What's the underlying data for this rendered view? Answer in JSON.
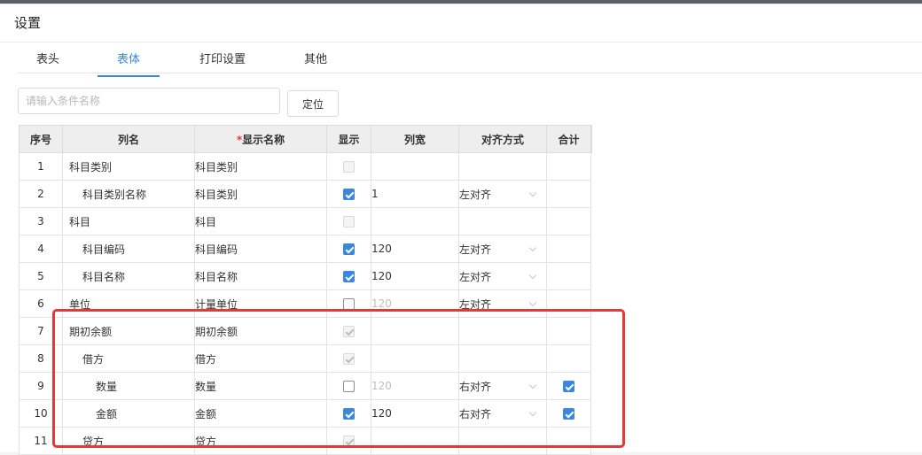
{
  "dialog": {
    "title": "设置"
  },
  "tabs": [
    {
      "label": "表头",
      "active": false
    },
    {
      "label": "表体",
      "active": true
    },
    {
      "label": "打印设置",
      "active": false
    },
    {
      "label": "其他",
      "active": false
    }
  ],
  "search": {
    "placeholder": "请输入条件名称",
    "value": "",
    "button_label": "定位"
  },
  "table": {
    "headers": {
      "no": "序号",
      "col_name": "列名",
      "required_mark": "*",
      "display_name": "显示名称",
      "show": "显示",
      "width": "列宽",
      "align": "对齐方式",
      "sum": "合计"
    },
    "rows": [
      {
        "no": "1",
        "col_name": "科目类别",
        "indent": 0,
        "display_name": "科目类别",
        "show": "disabled",
        "width": "",
        "width_muted": false,
        "align": "",
        "sum": ""
      },
      {
        "no": "2",
        "col_name": "科目类别名称",
        "indent": 1,
        "display_name": "科目类别",
        "show": "checked",
        "width": "1",
        "width_muted": false,
        "align": "左对齐",
        "sum": ""
      },
      {
        "no": "3",
        "col_name": "科目",
        "indent": 0,
        "display_name": "科目",
        "show": "disabled",
        "width": "",
        "width_muted": false,
        "align": "",
        "sum": ""
      },
      {
        "no": "4",
        "col_name": "科目编码",
        "indent": 1,
        "display_name": "科目编码",
        "show": "checked",
        "width": "120",
        "width_muted": false,
        "align": "左对齐",
        "sum": ""
      },
      {
        "no": "5",
        "col_name": "科目名称",
        "indent": 1,
        "display_name": "科目名称",
        "show": "checked",
        "width": "120",
        "width_muted": false,
        "align": "左对齐",
        "sum": ""
      },
      {
        "no": "6",
        "col_name": "单位",
        "indent": 0,
        "display_name": "计量单位",
        "show": "empty",
        "width": "120",
        "width_muted": true,
        "align": "左对齐",
        "sum": ""
      },
      {
        "no": "7",
        "col_name": "期初余额",
        "indent": 0,
        "display_name": "期初余额",
        "show": "disabled-checked",
        "width": "",
        "width_muted": false,
        "align": "",
        "sum": ""
      },
      {
        "no": "8",
        "col_name": "借方",
        "indent": 1,
        "display_name": "借方",
        "show": "disabled-checked",
        "width": "",
        "width_muted": false,
        "align": "",
        "sum": ""
      },
      {
        "no": "9",
        "col_name": "数量",
        "indent": 2,
        "display_name": "数量",
        "show": "empty",
        "width": "120",
        "width_muted": true,
        "align": "右对齐",
        "sum": "checked"
      },
      {
        "no": "10",
        "col_name": "金额",
        "indent": 2,
        "display_name": "金额",
        "show": "checked",
        "width": "120",
        "width_muted": false,
        "align": "右对齐",
        "sum": "checked"
      },
      {
        "no": "11",
        "col_name": "贷方",
        "indent": 1,
        "display_name": "贷方",
        "show": "disabled-checked",
        "width": "",
        "width_muted": false,
        "align": "",
        "sum": ""
      }
    ]
  },
  "colors": {
    "accent": "#3a86e0",
    "highlight": "#e53935"
  },
  "icons": {
    "checkbox": "checkbox-icon",
    "dropdown": "chevron-down-icon"
  }
}
